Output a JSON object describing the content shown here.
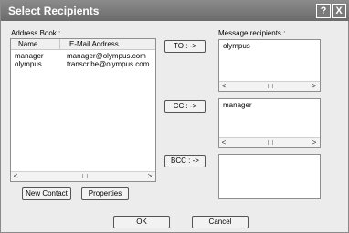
{
  "title": "Select Recipients",
  "titlebar": {
    "help": "?",
    "close": "X"
  },
  "address_book": {
    "label": "Address Book :",
    "columns": [
      "Name",
      "E-Mail Address"
    ],
    "rows": [
      {
        "name": "manager",
        "email": "manager@olympus.com"
      },
      {
        "name": "olympus",
        "email": "transcribe@olympus.com"
      }
    ],
    "new_contact": "New Contact",
    "properties": "Properties"
  },
  "buttons": {
    "to": "TO : ->",
    "cc": "CC : ->",
    "bcc": "BCC : ->",
    "ok": "OK",
    "cancel": "Cancel"
  },
  "recipients": {
    "label": "Message recipients :",
    "to": "olympus",
    "cc": "manager",
    "bcc": ""
  }
}
